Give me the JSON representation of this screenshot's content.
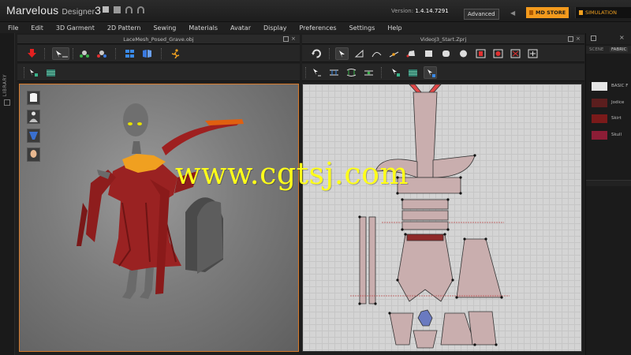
{
  "app": {
    "name": "Marvelous",
    "product": "Designer",
    "major_version": "3",
    "version_label": "Version:",
    "version_value": "1.4.14.7291",
    "mode": "Advanced",
    "md_store_label": "MD STORE",
    "simulation_label": "SIMULATION",
    "accent_color": "#f39a1d"
  },
  "menu": [
    "File",
    "Edit",
    "3D Garment",
    "2D Pattern",
    "Sewing",
    "Materials",
    "Avatar",
    "Display",
    "Preferences",
    "Settings",
    "Help"
  ],
  "library": {
    "label": "LIBRARY"
  },
  "panels": {
    "view3d": {
      "title": "LaceMesh_Posed_Grave.obj",
      "border_color": "#d87a2b"
    },
    "view2d": {
      "title": "VideoJ3_Start.Zprj"
    }
  },
  "right_panel": {
    "tabs": [
      "SCENE",
      "FABRIC"
    ],
    "fabrics": [
      {
        "name": "BASIC F",
        "color": "#e6e6e6"
      },
      {
        "name": "Jodice",
        "color": "#5b1e1e"
      },
      {
        "name": "Skirt",
        "color": "#7a1a1a"
      },
      {
        "name": "Skull",
        "color": "#8c1d36"
      }
    ]
  },
  "watermark": "www.cgtsj.com"
}
